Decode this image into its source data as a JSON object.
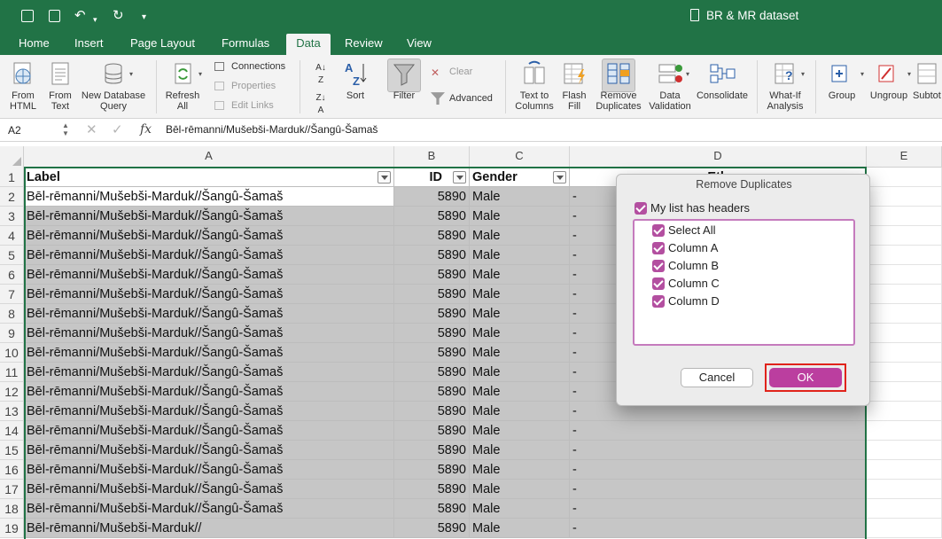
{
  "window": {
    "title": "BR & MR dataset",
    "doc_icon": "excel-document-icon"
  },
  "quick_access": {
    "icons": [
      "sidebar-icon",
      "save-icon",
      "undo-icon",
      "redo-icon",
      "customize-icon"
    ],
    "undo_glyph": "↶",
    "redo_glyph": "↻",
    "more_glyph": "▾"
  },
  "tabs": [
    "Home",
    "Insert",
    "Page Layout",
    "Formulas",
    "Data",
    "Review",
    "View"
  ],
  "active_tab": "Data",
  "ribbon": {
    "from_html": "From\nHTML",
    "from_text": "From\nText",
    "new_db_query": "New Database\nQuery",
    "refresh_all": "Refresh\nAll",
    "connections": "Connections",
    "properties": "Properties",
    "edit_links": "Edit Links",
    "sort_az": "A↓Z",
    "sort": "Sort",
    "filter": "Filter",
    "clear": "Clear",
    "advanced": "Advanced",
    "text_to_columns": "Text to\nColumns",
    "flash_fill": "Flash\nFill",
    "remove_duplicates": "Remove\nDuplicates",
    "data_validation": "Data\nValidation",
    "consolidate": "Consolidate",
    "what_if": "What-If\nAnalysis",
    "group": "Group",
    "ungroup": "Ungroup",
    "subtotal": "Subtot"
  },
  "formula_bar": {
    "cell_ref": "A2",
    "cancel": "✕",
    "confirm": "✓",
    "fx": "fx",
    "content": "Bēl-rēmanni/Mušebši-Marduk//Šangû-Šamaš"
  },
  "columns": [
    "A",
    "B",
    "C",
    "D",
    "E"
  ],
  "headers": {
    "label": "Label",
    "id": "ID",
    "gender": "Gender",
    "d": "Eth"
  },
  "rows": [
    {
      "n": "2",
      "label": "Bēl-rēmanni/Mušebši-Marduk//Šangû-Šamaš",
      "id": "5890",
      "gender": "Male",
      "d": "-"
    },
    {
      "n": "3",
      "label": "Bēl-rēmanni/Mušebši-Marduk//Šangû-Šamaš",
      "id": "5890",
      "gender": "Male",
      "d": "-"
    },
    {
      "n": "4",
      "label": "Bēl-rēmanni/Mušebši-Marduk//Šangû-Šamaš",
      "id": "5890",
      "gender": "Male",
      "d": "-"
    },
    {
      "n": "5",
      "label": "Bēl-rēmanni/Mušebši-Marduk//Šangû-Šamaš",
      "id": "5890",
      "gender": "Male",
      "d": "-"
    },
    {
      "n": "6",
      "label": "Bēl-rēmanni/Mušebši-Marduk//Šangû-Šamaš",
      "id": "5890",
      "gender": "Male",
      "d": "-"
    },
    {
      "n": "7",
      "label": "Bēl-rēmanni/Mušebši-Marduk//Šangû-Šamaš",
      "id": "5890",
      "gender": "Male",
      "d": "-"
    },
    {
      "n": "8",
      "label": "Bēl-rēmanni/Mušebši-Marduk//Šangû-Šamaš",
      "id": "5890",
      "gender": "Male",
      "d": "-"
    },
    {
      "n": "9",
      "label": "Bēl-rēmanni/Mušebši-Marduk//Šangû-Šamaš",
      "id": "5890",
      "gender": "Male",
      "d": "-"
    },
    {
      "n": "10",
      "label": "Bēl-rēmanni/Mušebši-Marduk//Šangû-Šamaš",
      "id": "5890",
      "gender": "Male",
      "d": "-"
    },
    {
      "n": "11",
      "label": "Bēl-rēmanni/Mušebši-Marduk//Šangû-Šamaš",
      "id": "5890",
      "gender": "Male",
      "d": "-"
    },
    {
      "n": "12",
      "label": "Bēl-rēmanni/Mušebši-Marduk//Šangû-Šamaš",
      "id": "5890",
      "gender": "Male",
      "d": "-"
    },
    {
      "n": "13",
      "label": "Bēl-rēmanni/Mušebši-Marduk//Šangû-Šamaš",
      "id": "5890",
      "gender": "Male",
      "d": "-"
    },
    {
      "n": "14",
      "label": "Bēl-rēmanni/Mušebši-Marduk//Šangû-Šamaš",
      "id": "5890",
      "gender": "Male",
      "d": "-"
    },
    {
      "n": "15",
      "label": "Bēl-rēmanni/Mušebši-Marduk//Šangû-Šamaš",
      "id": "5890",
      "gender": "Male",
      "d": "-"
    },
    {
      "n": "16",
      "label": "Bēl-rēmanni/Mušebši-Marduk//Šangû-Šamaš",
      "id": "5890",
      "gender": "Male",
      "d": "-"
    },
    {
      "n": "17",
      "label": "Bēl-rēmanni/Mušebši-Marduk//Šangû-Šamaš",
      "id": "5890",
      "gender": "Male",
      "d": "-"
    },
    {
      "n": "18",
      "label": "Bēl-rēmanni/Mušebši-Marduk//Šangû-Šamaš",
      "id": "5890",
      "gender": "Male",
      "d": "-"
    },
    {
      "n": "19",
      "label": "Bēl-rēmanni/Mušebši-Marduk//",
      "id": "5890",
      "gender": "Male",
      "d": "-"
    }
  ],
  "dialog": {
    "title": "Remove Duplicates",
    "has_headers": "My list has headers",
    "items": [
      "Select All",
      "Column A",
      "Column B",
      "Column C",
      "Column D"
    ],
    "cancel": "Cancel",
    "ok": "OK"
  },
  "colors": {
    "brand": "#217346",
    "accent": "#bb3e9f",
    "highlight": "#e0231b"
  }
}
